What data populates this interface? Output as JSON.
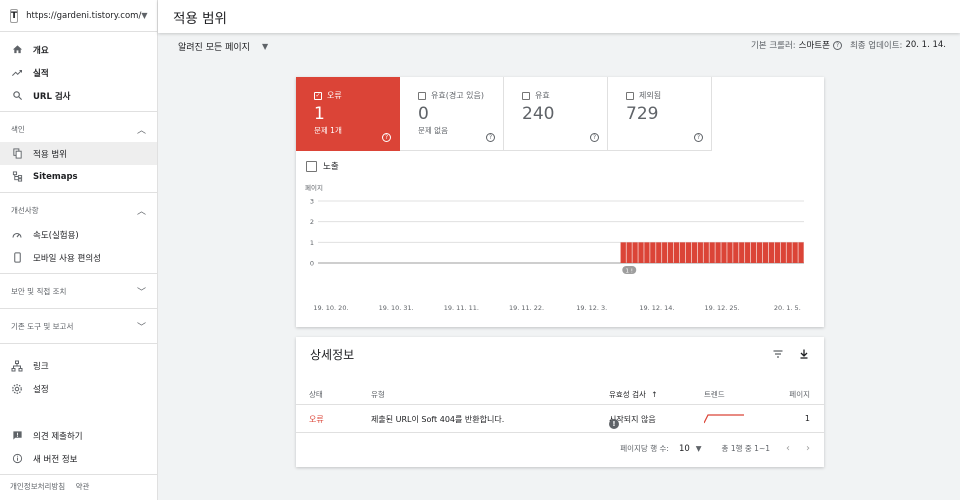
{
  "property": {
    "url": "https://gardeni.tistory.com/"
  },
  "sidebar": {
    "items_top": [
      {
        "label": "개요",
        "icon": "home-icon"
      },
      {
        "label": "실적",
        "icon": "trending-up-icon"
      },
      {
        "label": "URL 검사",
        "icon": "search-icon"
      }
    ],
    "index_section": "색인",
    "index_items": [
      {
        "label": "적용 범위",
        "icon": "file-copy-icon"
      },
      {
        "label": "Sitemaps",
        "icon": "sitemap-icon"
      }
    ],
    "enh_section": "개선사항",
    "enh_items": [
      {
        "label": "속도(실험용)",
        "icon": "speed-icon"
      },
      {
        "label": "모바일 사용 편의성",
        "icon": "phone-icon"
      }
    ],
    "security_section": "보안 및 직접 조치",
    "legacy_section": "기존 도구 및 보고서",
    "items_bottom": [
      {
        "label": "링크",
        "icon": "links-icon"
      },
      {
        "label": "설정",
        "icon": "settings-icon"
      }
    ],
    "feedback": "의견 제출하기",
    "whats_new": "새 버전 정보",
    "privacy": "개인정보처리방침",
    "terms": "약관"
  },
  "header": {
    "title": "적용 범위"
  },
  "filter": {
    "label": "알려진 모든 페이지",
    "crawler_label": "기본 크롤러:",
    "crawler_value": "스마트폰",
    "updated_label": "최종 업데이트:",
    "updated_value": "20. 1. 14."
  },
  "tiles": [
    {
      "label": "오류",
      "value": "1",
      "sub": "문제 1개",
      "checked": "✓"
    },
    {
      "label": "유효(경고 있음)",
      "value": "0",
      "sub": "문제 없음",
      "checked": ""
    },
    {
      "label": "유효",
      "value": "240",
      "sub": "",
      "checked": ""
    },
    {
      "label": "제외됨",
      "value": "729",
      "sub": "",
      "checked": ""
    }
  ],
  "expose_label": "노출",
  "chart_data": {
    "type": "bar",
    "ylabel": "페이지",
    "ylim": [
      0,
      3
    ],
    "yticks": [
      "3",
      "2",
      "1",
      "0"
    ],
    "xticks": [
      "19. 10. 20.",
      "19. 10. 31.",
      "19. 11. 11.",
      "19. 11. 22.",
      "19. 12. 3.",
      "19. 12. 14.",
      "19. 12. 25.",
      "20. 1. 5."
    ],
    "start_index": 51,
    "total_days": 82,
    "series": [
      {
        "values": [
          1,
          1,
          1,
          1,
          1,
          1,
          1,
          1,
          1,
          1,
          1,
          1,
          1,
          1,
          1,
          1,
          1,
          1,
          1,
          1,
          1,
          1,
          1,
          1,
          1,
          1,
          1,
          1,
          1,
          1,
          1
        ]
      }
    ],
    "annotation": "1 !",
    "color": "#db4437"
  },
  "details": {
    "title": "상세정보",
    "headers": {
      "status": "상태",
      "type": "유형",
      "validation": "유효성 검사",
      "trend": "트렌드",
      "pages": "페이지"
    },
    "rows": [
      {
        "status": "오류",
        "type": "제출된 URL이 Soft 404를 반환합니다.",
        "validation": "시작되지 않음",
        "pages": "1"
      }
    ],
    "pager": {
      "rpp_label": "페이지당 행 수:",
      "rpp_value": "10",
      "range": "총 1행 중 1~1"
    }
  }
}
